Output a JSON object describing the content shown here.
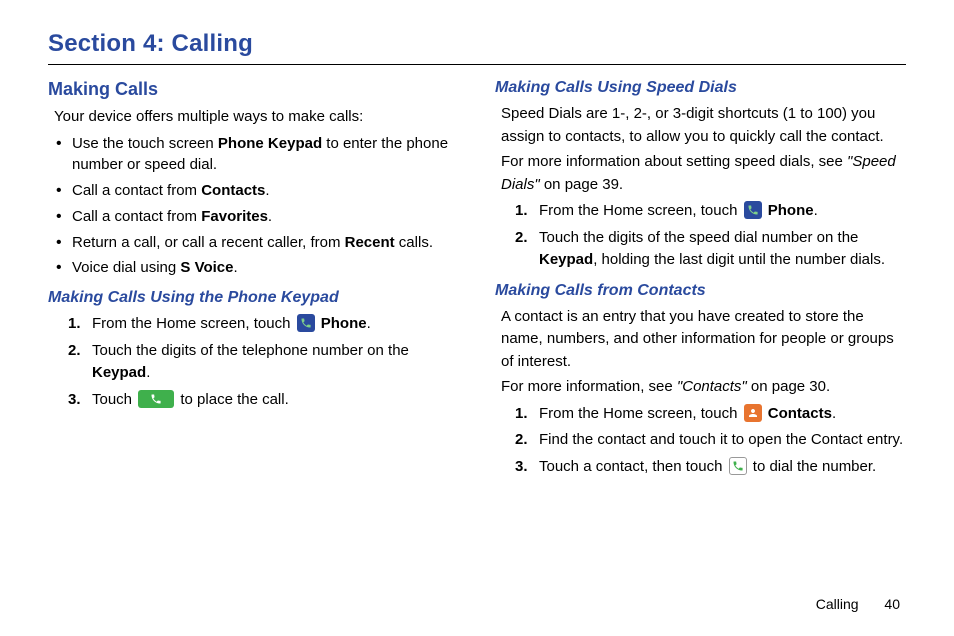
{
  "section_title": "Section 4: Calling",
  "left": {
    "h2": "Making Calls",
    "intro": "Your device offers multiple ways to make calls:",
    "bullets": {
      "b1a": "Use the touch screen ",
      "b1b": "Phone Keypad",
      "b1c": " to enter the phone number or speed dial.",
      "b2a": "Call a contact from ",
      "b2b": "Contacts",
      "b2c": ".",
      "b3a": "Call a contact from ",
      "b3b": "Favorites",
      "b3c": ".",
      "b4a": "Return a call, or call a recent caller, from ",
      "b4b": "Recent",
      "b4c": " calls.",
      "b5a": "Voice dial using ",
      "b5b": "S Voice",
      "b5c": "."
    },
    "h3": "Making Calls Using the Phone Keypad",
    "steps": {
      "s1a": "From the Home screen, touch ",
      "s1b": " Phone",
      "s1c": ".",
      "s2a": "Touch the digits of the telephone number on the ",
      "s2b": "Keypad",
      "s2c": ".",
      "s3a": "Touch ",
      "s3b": " to place the call."
    }
  },
  "right": {
    "h3a": "Making Calls Using Speed Dials",
    "p1": "Speed Dials are 1-, 2-, or 3-digit shortcuts (1 to 100) you assign to contacts, to allow you to quickly call the contact.",
    "p2a": "For more information about setting speed dials, see ",
    "p2b": "\"Speed Dials\"",
    "p2c": " on page 39.",
    "stepsA": {
      "s1a": "From the Home screen, touch ",
      "s1b": " Phone",
      "s1c": ".",
      "s2a": "Touch the digits of the speed dial number on the ",
      "s2b": "Keypad",
      "s2c": ", holding the last digit until the number dials."
    },
    "h3b": "Making Calls from Contacts",
    "p3": "A contact is an entry that you have created to store the name, numbers, and other information for people or groups of interest.",
    "p4a": "For more information, see ",
    "p4b": "\"Contacts\"",
    "p4c": " on page 30.",
    "stepsB": {
      "s1a": "From the Home screen, touch ",
      "s1b": " Contacts",
      "s1c": ".",
      "s2": "Find the contact and touch it to open the Contact entry.",
      "s3a": "Touch a contact, then touch ",
      "s3b": " to dial the number."
    }
  },
  "footer": {
    "label": "Calling",
    "page": "40"
  }
}
